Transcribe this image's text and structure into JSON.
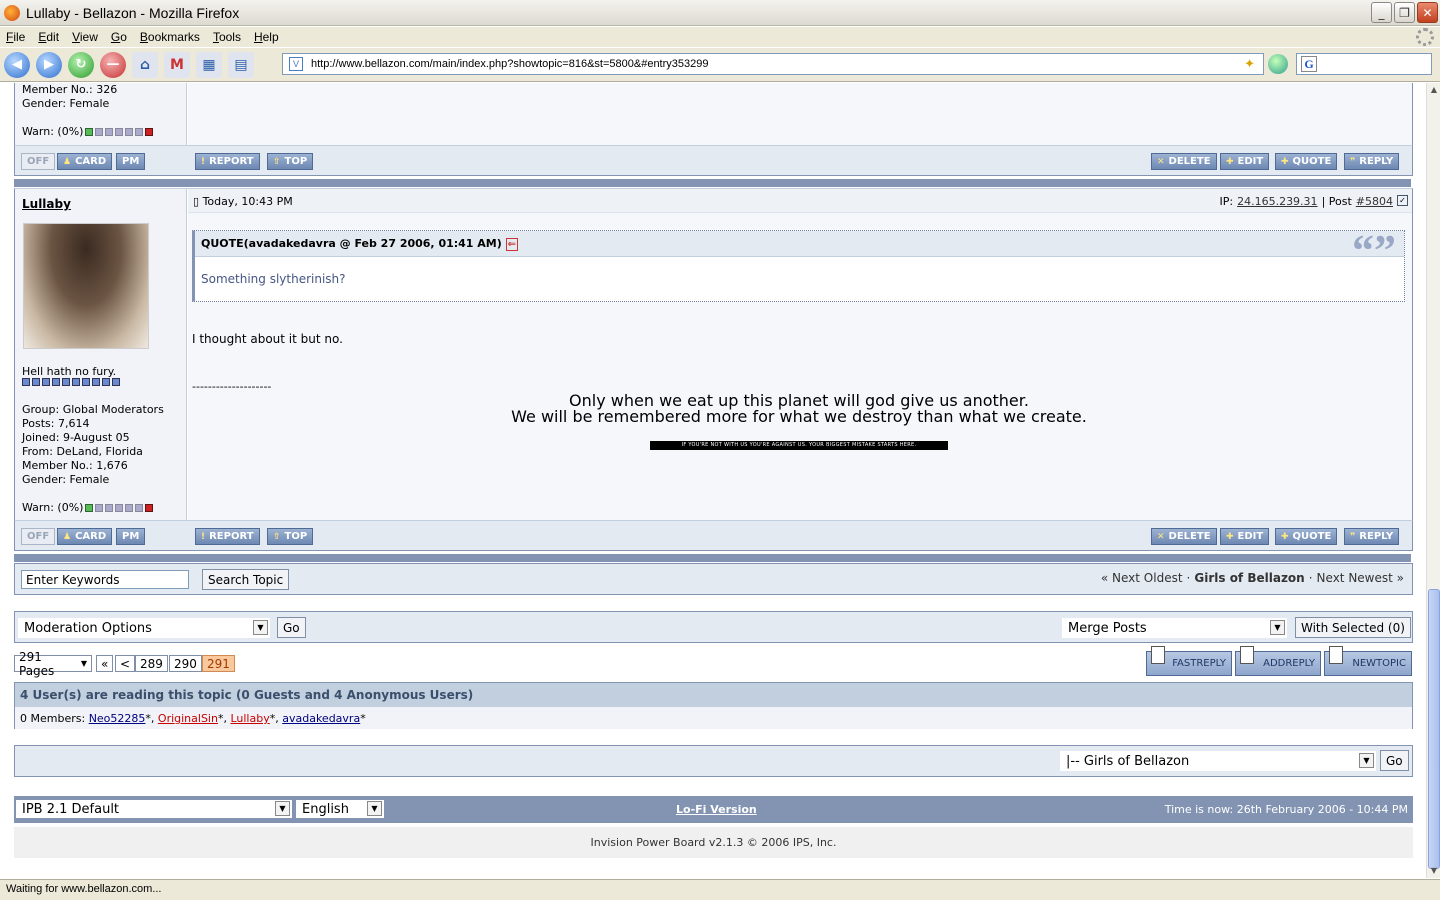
{
  "window": {
    "title": "Lullaby - Bellazon - Mozilla Firefox"
  },
  "menu": [
    "File",
    "Edit",
    "View",
    "Go",
    "Bookmarks",
    "Tools",
    "Help"
  ],
  "address": {
    "url": "http://www.bellazon.com/main/index.php?showtopic=816&st=5800&#entry353299"
  },
  "status": {
    "text": "Waiting for www.bellazon.com..."
  },
  "prev_post": {
    "member_no": "Member No.: 326",
    "gender": "Gender: Female",
    "warn": "Warn: (0%)"
  },
  "buttons": {
    "off": "OFF",
    "card": "CARD",
    "pm": "PM",
    "report": "REPORT",
    "top": "TOP",
    "delete": "DELETE",
    "edit": "EDIT",
    "quote": "QUOTE",
    "reply": "REPLY"
  },
  "post": {
    "author": "Lullaby",
    "time": "Today, 10:43 PM",
    "ip_label": "IP:",
    "ip": "24.165.239.31",
    "post_label": "| Post",
    "post_no": "#5804",
    "member_title": "Hell hath no fury.",
    "group": "Group: Global Moderators",
    "posts": "Posts: 7,614",
    "joined": "Joined: 9-August 05",
    "from": "From: DeLand, Florida",
    "member_no": "Member No.: 1,676",
    "gender": "Gender: Female",
    "warn": "Warn: (0%)",
    "quote_head": "QUOTE(avadakedavra @ Feb 27 2006, 01:41 AM)",
    "quote_body": "Something slytherinish?",
    "message": "I thought about it but no.",
    "sig_divider": "--------------------",
    "sig_line1": "Only when we eat up this planet will god give us another.",
    "sig_line2": "We will be remembered more for what we destroy than what we create.",
    "sig_banner": "IF YOU'RE NOT WITH US YOU'RE AGAINST US. YOUR BIGGEST MISTAKE STARTS HERE."
  },
  "search": {
    "placeholder": "Enter Keywords",
    "button": "Search Topic",
    "next_oldest": "« Next Oldest",
    "sep": "·",
    "forum": "Girls of Bellazon",
    "next_newest": "Next Newest »"
  },
  "moderation": {
    "options": "Moderation Options",
    "go": "Go",
    "merge": "Merge Posts",
    "with_selected": "With Selected (0)"
  },
  "pagination": {
    "pages": "291 Pages",
    "first": "«",
    "prev": "<",
    "items": [
      "289",
      "290"
    ],
    "current": "291"
  },
  "actions": {
    "fastreply": "FASTREPLY",
    "addreply": "ADDREPLY",
    "newtopic": "NEWTOPIC"
  },
  "active": {
    "header": "4 User(s) are reading this topic (0 Guests and 4 Anonymous Users)",
    "prefix": "0 Members:",
    "users": [
      "Neo52285",
      "OriginalSin",
      "Lullaby",
      "avadakedavra"
    ],
    "star": "*"
  },
  "jump": {
    "forum": "|-- Girls of Bellazon",
    "go": "Go"
  },
  "footer": {
    "skin": "IPB 2.1 Default",
    "language": "English",
    "lofi": "Lo-Fi Version",
    "time": "Time is now: 26th February 2006 - 10:44 PM",
    "copyright": "Invision Power Board v2.1.3 © 2006  IPS, Inc."
  },
  "colors": {
    "accent": "#8394b2",
    "light": "#e4eaf2",
    "link": "#000080"
  }
}
